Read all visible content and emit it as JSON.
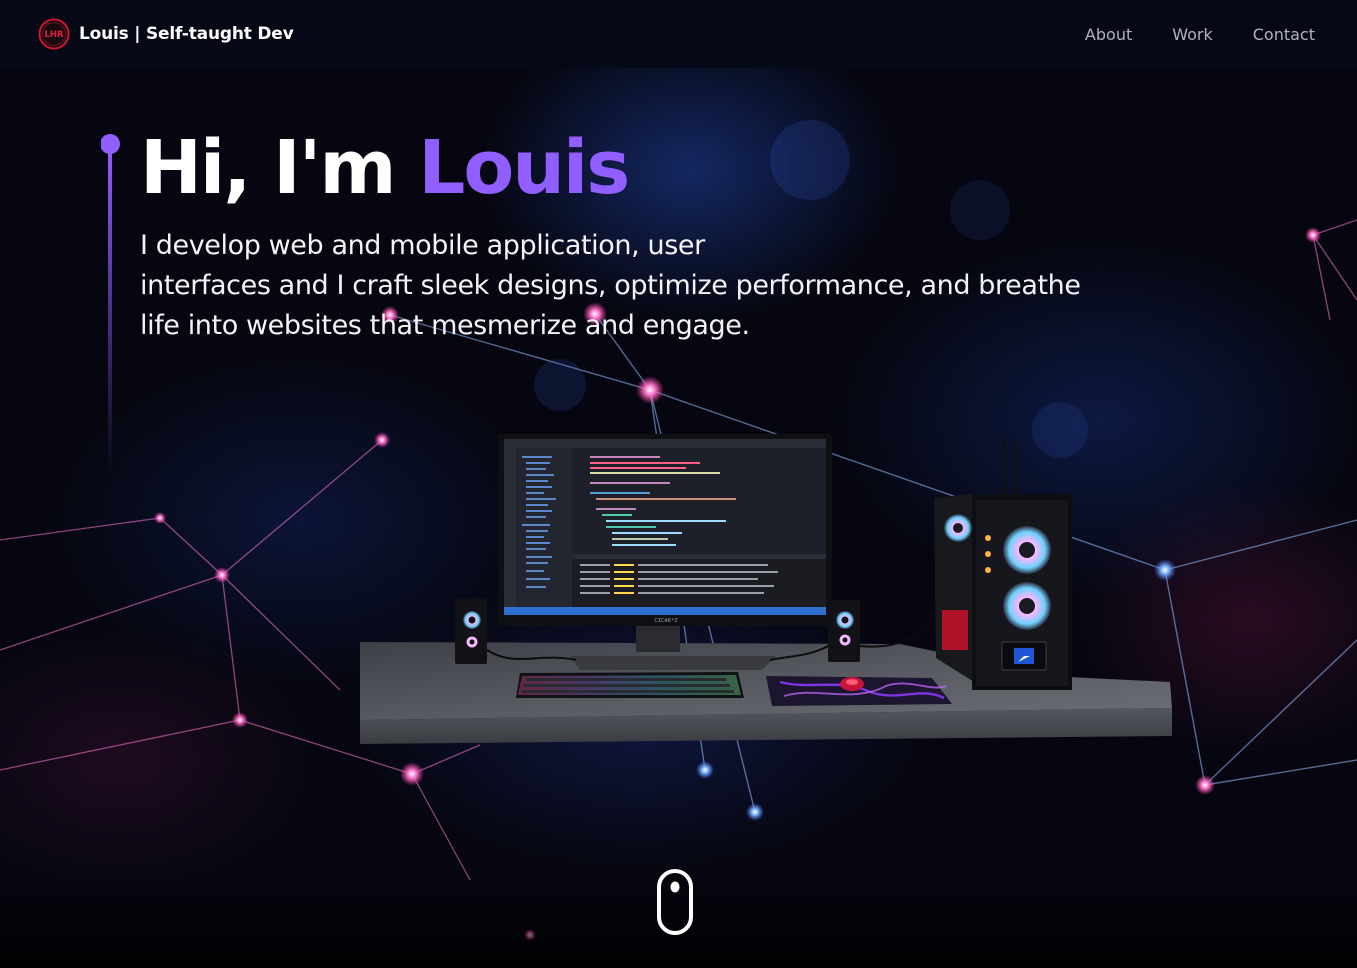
{
  "navbar": {
    "brand_name": "Louis | Self-taught Dev",
    "logo_icon": "lhr-logo-icon",
    "links": [
      {
        "label": "About"
      },
      {
        "label": "Work"
      },
      {
        "label": "Contact"
      }
    ]
  },
  "hero": {
    "greeting": "Hi, I'm ",
    "name": "Louis",
    "subtitle_lines": [
      "I develop web and mobile application, user",
      "interfaces and I craft sleek designs, optimize performance, and breathe",
      "life into websites that mesmerize and engage."
    ]
  },
  "scene": {
    "icon": "desk-setup-3d-icon",
    "monitor_brand": "CICA6*Z"
  },
  "scroll": {
    "icon": "mouse-scroll-icon"
  },
  "colors": {
    "accent": "#915eff",
    "background": "#05060f",
    "nav_text": "#aeb1c0",
    "logo_red": "#d0162e"
  }
}
